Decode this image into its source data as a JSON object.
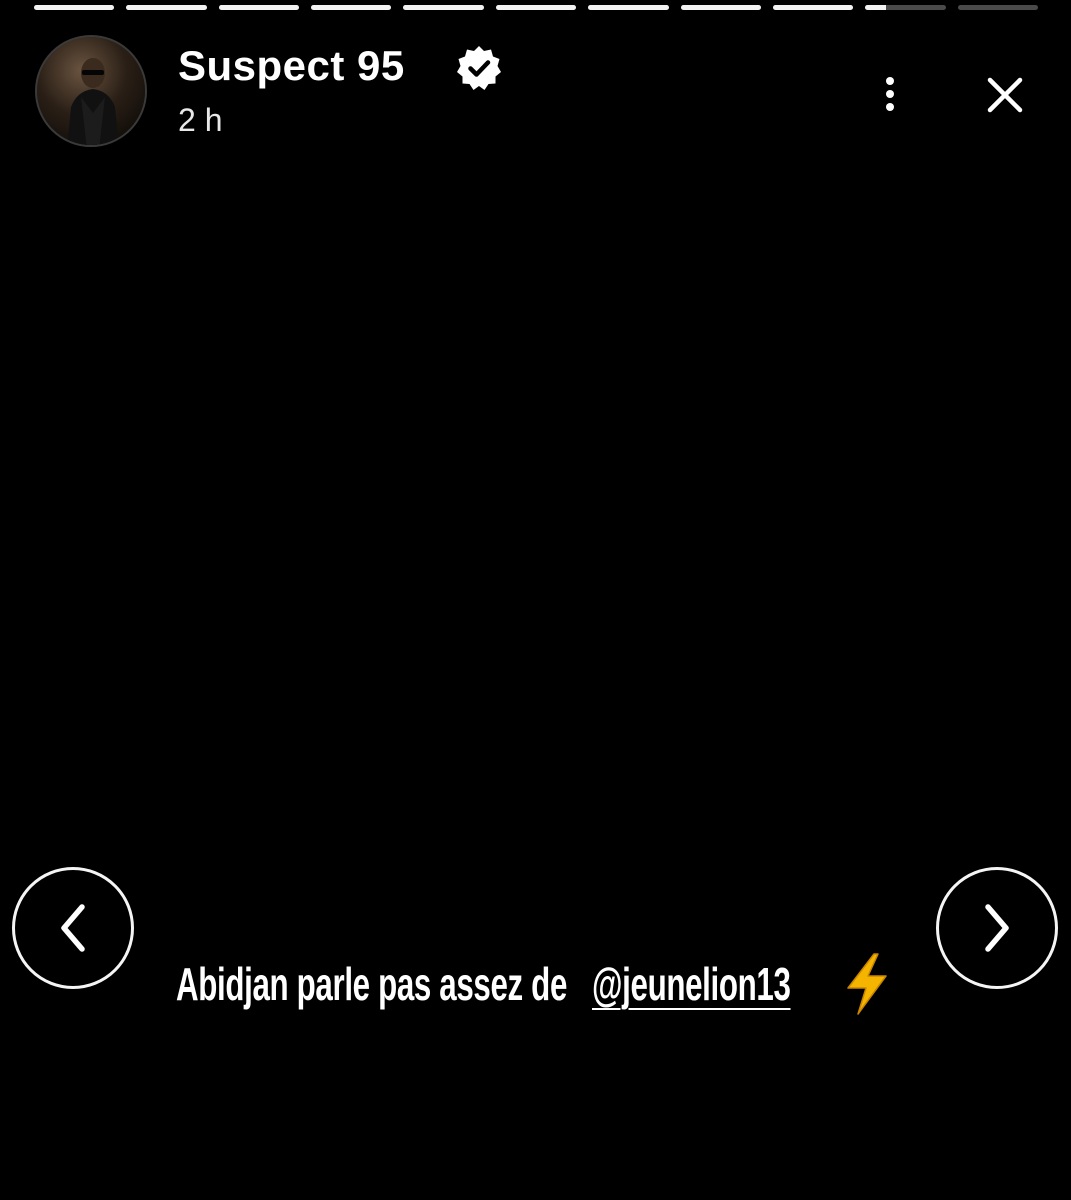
{
  "story": {
    "progress": {
      "segments": [
        1,
        1,
        1,
        1,
        1,
        1,
        1,
        1,
        1,
        0.26,
        0
      ]
    },
    "author": {
      "name": "Suspect 95",
      "verified": true,
      "avatar_icon": "avatar-photo",
      "posted_ago": "2 h"
    },
    "header_actions": {
      "more_icon": "more-vertical-icon",
      "close_icon": "close-icon"
    },
    "navigation": {
      "prev_icon": "chevron-left-icon",
      "next_icon": "chevron-right-icon"
    },
    "caption": {
      "text": "Abidjan parle pas assez de",
      "mention": "@jeunelion13",
      "emoji": "⚡"
    },
    "colors": {
      "background": "#000000",
      "progress_active": "#f2f2f2",
      "progress_inactive": "#4a4a4a",
      "text": "#ffffff",
      "bolt": "#f5b400"
    }
  }
}
